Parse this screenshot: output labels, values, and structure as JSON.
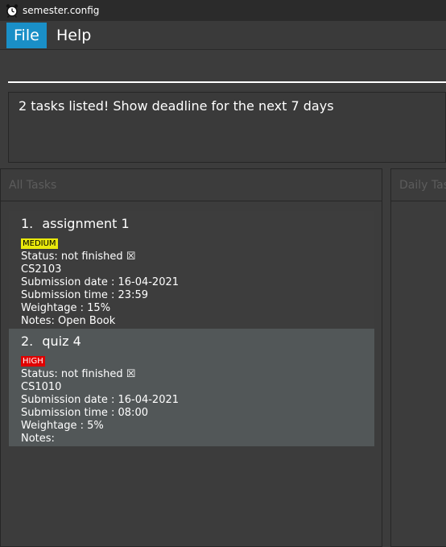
{
  "window": {
    "title": "semester.config"
  },
  "menu": {
    "file": "File",
    "help": "Help"
  },
  "command": {
    "value": ""
  },
  "result": {
    "message": "2 tasks listed! Show deadline for the next 7 days"
  },
  "panels": {
    "all_tasks": "All Tasks",
    "daily_tasks": "Daily Tasks"
  },
  "tasks": [
    {
      "index": "1.",
      "title": "assignment 1",
      "priority": "MEDIUM",
      "status": "Status: not finished ☒",
      "module": "CS2103",
      "date": "Submission date : 16-04-2021",
      "time": "Submission time : 23:59",
      "weightage": "Weightage : 15%",
      "notes": "Notes: Open Book"
    },
    {
      "index": "2.",
      "title": "quiz 4",
      "priority": "HIGH",
      "status": "Status: not finished ☒",
      "module": "CS1010",
      "date": "Submission date : 16-04-2021",
      "time": "Submission time : 08:00",
      "weightage": "Weightage : 5%",
      "notes": "Notes:"
    }
  ],
  "colors": {
    "accent": "#1a8fc7",
    "medium": "#e9e90c",
    "high": "#e00000",
    "background": "#3c3c3c"
  }
}
